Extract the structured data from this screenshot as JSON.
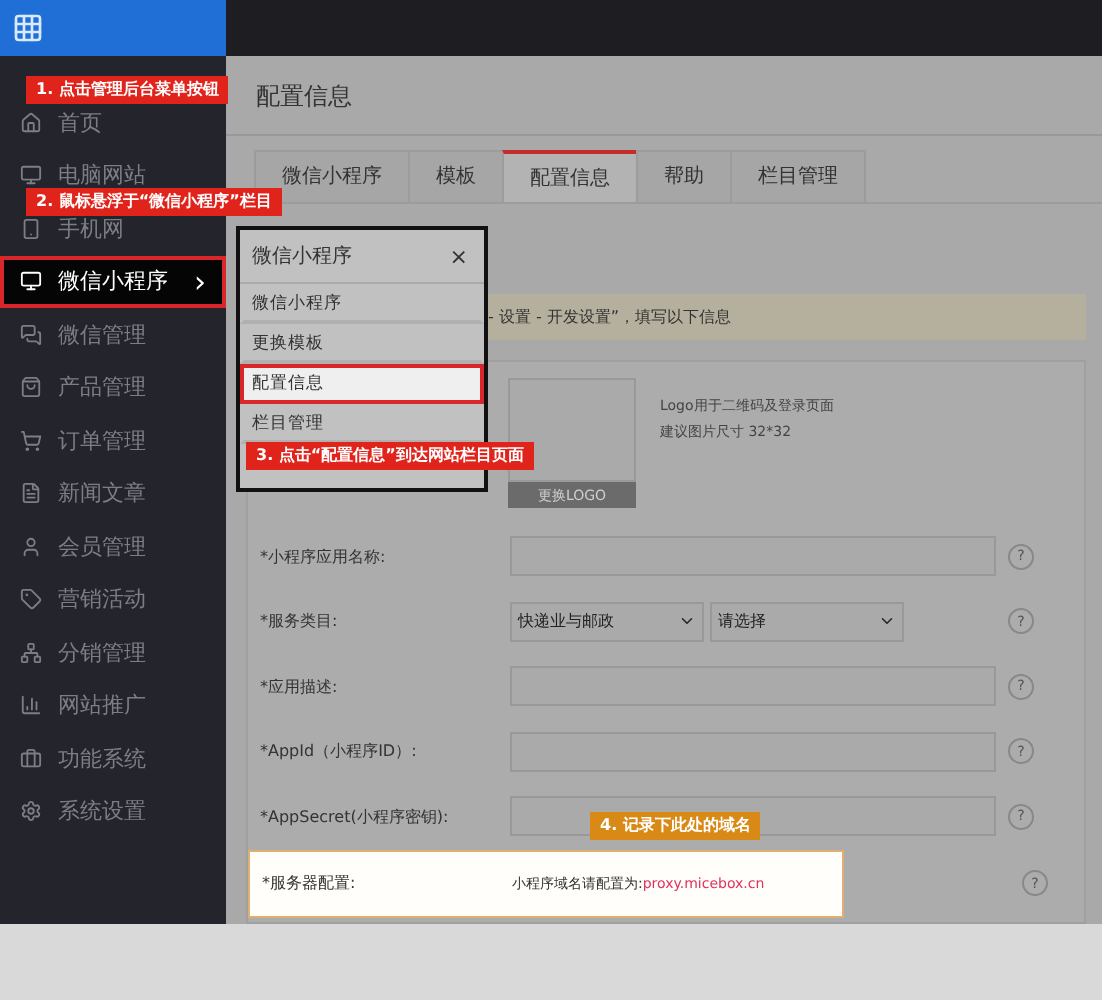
{
  "sidebar": {
    "items": [
      {
        "label": "首页",
        "selected": false,
        "marked": false
      },
      {
        "label": "电脑网站",
        "selected": false,
        "marked": false
      },
      {
        "label": "手机网",
        "selected": false,
        "marked": false
      },
      {
        "label": "微信小程序",
        "selected": true,
        "marked": true,
        "arrow": "›"
      },
      {
        "label": "微信管理",
        "selected": false,
        "marked": false
      },
      {
        "label": "产品管理",
        "selected": false,
        "marked": false
      },
      {
        "label": "订单管理",
        "selected": false,
        "marked": false
      },
      {
        "label": "新闻文章",
        "selected": false,
        "marked": false
      },
      {
        "label": "会员管理",
        "selected": false,
        "marked": false
      },
      {
        "label": "营销活动",
        "selected": false,
        "marked": false
      },
      {
        "label": "分销管理",
        "selected": false,
        "marked": false
      },
      {
        "label": "网站推广",
        "selected": false,
        "marked": false
      },
      {
        "label": "功能系统",
        "selected": false,
        "marked": false
      },
      {
        "label": "系统设置",
        "selected": false,
        "marked": false
      }
    ]
  },
  "page_title": "配置信息",
  "tabs": [
    {
      "label": "微信小程序",
      "selected": false
    },
    {
      "label": "模板",
      "selected": false
    },
    {
      "label": "配置信息",
      "selected": true
    },
    {
      "label": "帮助",
      "selected": false
    },
    {
      "label": "栏目管理",
      "selected": false
    }
  ],
  "notice": "- 设置 - 开发设置”，填写以下信息",
  "popup": {
    "title": "微信小程序",
    "close": "×",
    "items": [
      {
        "label": "微信小程序",
        "selected": false,
        "marked": false
      },
      {
        "label": "更换模板",
        "selected": false,
        "marked": false
      },
      {
        "label": "配置信息",
        "selected": true,
        "marked": true
      },
      {
        "label": "栏目管理",
        "selected": false,
        "marked": false
      }
    ]
  },
  "logo": {
    "hint": [
      "Logo用于二维码及登录页面",
      "建议图片尺寸 32*32"
    ],
    "button": "更换LOGO"
  },
  "form": [
    {
      "kind": "input",
      "label": "*小程序应用名称:",
      "help": "?"
    },
    {
      "kind": "select",
      "label": "*服务类目:",
      "options": [
        "快递业与邮政",
        "请选择"
      ],
      "help": "?"
    },
    {
      "kind": "input",
      "label": "*应用描述:",
      "help": "?"
    },
    {
      "kind": "input",
      "label": "*AppId（小程序ID）:",
      "help": "?"
    },
    {
      "kind": "input",
      "label": "*AppSecret(小程序密钥):",
      "help": "?"
    },
    {
      "kind": "note",
      "label": "*服务器配置:",
      "text": "小程序域名请配置为:",
      "link": "proxy.micebox.cn",
      "help": "?",
      "highlighted": true
    }
  ],
  "callouts": [
    {
      "text": "1. 点击管理后台菜单按钮",
      "color": "#e0241c"
    },
    {
      "text": "2. 鼠标悬浮于“微信小程序”栏目",
      "color": "#e0241c"
    },
    {
      "text": "3. 点击“配置信息”到达网站栏目页面",
      "color": "#e0241c"
    },
    {
      "text": "4. 记录下此处的域名",
      "color": "#d98a16"
    }
  ]
}
